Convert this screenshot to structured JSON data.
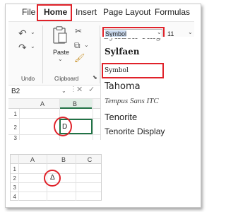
{
  "ribbon_tabs": [
    "File",
    "Home",
    "Insert",
    "Page Layout",
    "Formulas"
  ],
  "active_tab": "Home",
  "groups": {
    "undo": "Undo",
    "clipboard": "Clipboard"
  },
  "paste_label": "Paste",
  "font_combo": {
    "value": "Symbol",
    "size": "11"
  },
  "font_list": [
    {
      "name": "Sylfaen"
    },
    {
      "name": "Symbol"
    },
    {
      "name": "Tahoma"
    },
    {
      "name": "Tempus Sans ITC"
    },
    {
      "name": "Tenorite"
    },
    {
      "name": "Tenorite Display"
    }
  ],
  "selected_font": "Symbol",
  "name_box": "B2",
  "sheet1": {
    "columns": [
      "A",
      "B"
    ],
    "rows": [
      "1",
      "2",
      "3"
    ],
    "cell_b2": "D"
  },
  "sheet2": {
    "columns": [
      "A",
      "B",
      "C"
    ],
    "rows": [
      "1",
      "2",
      "3",
      "4"
    ],
    "cell_b2": "Δ"
  },
  "colors": {
    "accent": "#217346",
    "highlight": "#e0222a"
  }
}
